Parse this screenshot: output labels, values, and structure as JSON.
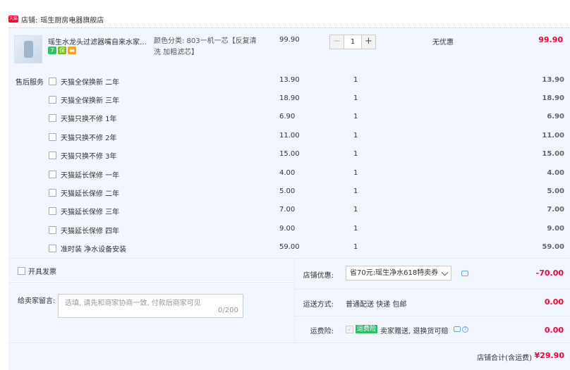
{
  "shop": {
    "icon_text": "天猫",
    "label": "店铺:",
    "name": "瑶生厨房电器旗舰店"
  },
  "product": {
    "title": "瑶生水龙头过滤器嘴自来水家用...",
    "sku": "颜色分类: 803一机一芯【反复清洗 加粗滤芯】",
    "price": "99.90",
    "quantity": "1",
    "promo": "无优惠",
    "total": "99.90",
    "badges": [
      {
        "icon": "seven-day-return",
        "text": "7",
        "color": "#2ec264"
      },
      {
        "icon": "guarantee-icon",
        "text": "保",
        "color": "#7bbd2c"
      },
      {
        "icon": "card-icon",
        "text": "▬",
        "color": "#f5a623"
      }
    ]
  },
  "services": {
    "label": "售后服务",
    "items": [
      {
        "name": "天猫全保换新 二年",
        "price": "13.90",
        "qty": "1",
        "total": "13.90"
      },
      {
        "name": "天猫全保换新 三年",
        "price": "18.90",
        "qty": "1",
        "total": "18.90"
      },
      {
        "name": "天猫只换不修 1年",
        "price": "6.90",
        "qty": "1",
        "total": "6.90"
      },
      {
        "name": "天猫只换不修 2年",
        "price": "11.00",
        "qty": "1",
        "total": "11.00"
      },
      {
        "name": "天猫只换不修 3年",
        "price": "15.00",
        "qty": "1",
        "total": "15.00"
      },
      {
        "name": "天猫延长保修 一年",
        "price": "4.00",
        "qty": "1",
        "total": "4.00"
      },
      {
        "name": "天猫延长保修 二年",
        "price": "5.00",
        "qty": "1",
        "total": "5.00"
      },
      {
        "name": "天猫延长保修 三年",
        "price": "7.00",
        "qty": "1",
        "total": "7.00"
      },
      {
        "name": "天猫延长保修 四年",
        "price": "9.00",
        "qty": "1",
        "total": "9.00"
      },
      {
        "name": "准时装 净水设备安装",
        "price": "59.00",
        "qty": "1",
        "total": "59.00"
      }
    ]
  },
  "invoice": {
    "label": "开具发票"
  },
  "message": {
    "label": "给卖家留言:",
    "placeholder": "选填, 请先和商家协商一致, 付款后商家可见",
    "count": "0/200"
  },
  "coupon": {
    "label": "店铺优惠:",
    "selected": "省70元:瑶生净水618特卖券",
    "amount": "-70.00"
  },
  "shipping": {
    "label": "运送方式:",
    "method": "普通配送 快递 包邮",
    "amount": "0.00"
  },
  "insurance": {
    "label": "运费险:",
    "tag": "运费险",
    "desc": "卖家赠送, 退换货可赔",
    "amount": "0.00"
  },
  "summary": {
    "label": "店铺合计(含运费)",
    "total": "¥29.90"
  },
  "colors": {
    "accent": "#ff0036",
    "panel_bg": "#f2f7ff",
    "link": "#6ea6e0"
  }
}
